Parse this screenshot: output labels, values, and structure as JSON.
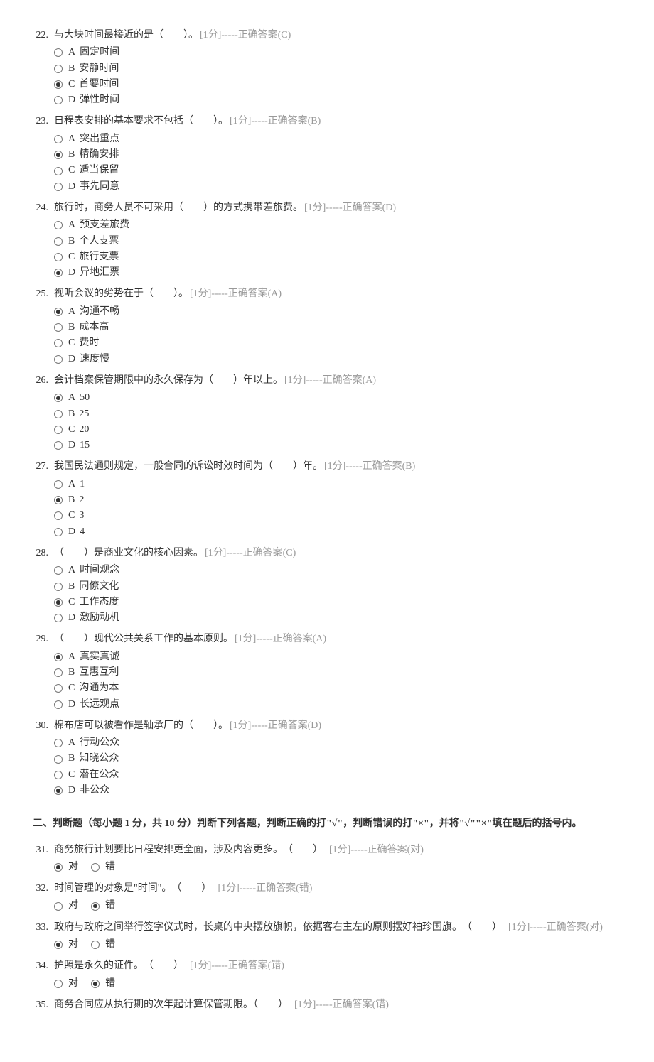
{
  "mc": [
    {
      "num": 22,
      "stem": "与大块时间最接近的是（　　）。",
      "score": "[1分]",
      "ans": "-----正确答案(C)",
      "opts": [
        {
          "l": "A",
          "t": "固定时间"
        },
        {
          "l": "B",
          "t": "安静时间"
        },
        {
          "l": "C",
          "t": "首要时间"
        },
        {
          "l": "D",
          "t": "弹性时间"
        }
      ],
      "sel": "C"
    },
    {
      "num": 23,
      "stem": "日程表安排的基本要求不包括（　　）。",
      "score": "[1分]",
      "ans": "-----正确答案(B)",
      "opts": [
        {
          "l": "A",
          "t": "突出重点"
        },
        {
          "l": "B",
          "t": "精确安排"
        },
        {
          "l": "C",
          "t": "适当保留"
        },
        {
          "l": "D",
          "t": "事先同意"
        }
      ],
      "sel": "B"
    },
    {
      "num": 24,
      "stem": "旅行时，商务人员不可采用（　　）的方式携带差旅费。",
      "score": "[1分]",
      "ans": "-----正确答案(D)",
      "opts": [
        {
          "l": "A",
          "t": "预支差旅费"
        },
        {
          "l": "B",
          "t": "个人支票"
        },
        {
          "l": "C",
          "t": "旅行支票"
        },
        {
          "l": "D",
          "t": "异地汇票"
        }
      ],
      "sel": "D"
    },
    {
      "num": 25,
      "stem": "视听会议的劣势在于（　　）。",
      "score": "[1分]",
      "ans": "-----正确答案(A)",
      "opts": [
        {
          "l": "A",
          "t": "沟通不畅"
        },
        {
          "l": "B",
          "t": "成本高"
        },
        {
          "l": "C",
          "t": "费时"
        },
        {
          "l": "D",
          "t": "速度慢"
        }
      ],
      "sel": "A"
    },
    {
      "num": 26,
      "stem": "会计档案保管期限中的永久保存为（　　）年以上。",
      "score": "[1分]",
      "ans": "-----正确答案(A)",
      "opts": [
        {
          "l": "A",
          "t": "50"
        },
        {
          "l": "B",
          "t": "25"
        },
        {
          "l": "C",
          "t": "20"
        },
        {
          "l": "D",
          "t": "15"
        }
      ],
      "sel": "A"
    },
    {
      "num": 27,
      "stem": "我国民法通则规定，一般合同的诉讼时效时间为（　　）年。",
      "score": "[1分]",
      "ans": "-----正确答案(B)",
      "opts": [
        {
          "l": "A",
          "t": "1"
        },
        {
          "l": "B",
          "t": "2"
        },
        {
          "l": "C",
          "t": "3"
        },
        {
          "l": "D",
          "t": "4"
        }
      ],
      "sel": "B"
    },
    {
      "num": 28,
      "stem": "（　　）是商业文化的核心因素。",
      "score": "[1分]",
      "ans": "-----正确答案(C)",
      "opts": [
        {
          "l": "A",
          "t": "时间观念"
        },
        {
          "l": "B",
          "t": "同僚文化"
        },
        {
          "l": "C",
          "t": "工作态度"
        },
        {
          "l": "D",
          "t": "激励动机"
        }
      ],
      "sel": "C"
    },
    {
      "num": 29,
      "stem": "（　　）现代公共关系工作的基本原则。",
      "score": "[1分]",
      "ans": "-----正确答案(A)",
      "opts": [
        {
          "l": "A",
          "t": "真实真诚"
        },
        {
          "l": "B",
          "t": "互惠互利"
        },
        {
          "l": "C",
          "t": "沟通为本"
        },
        {
          "l": "D",
          "t": "长远观点"
        }
      ],
      "sel": "A"
    },
    {
      "num": 30,
      "stem": "棉布店可以被看作是轴承厂的（　　）。",
      "score": "[1分]",
      "ans": "-----正确答案(D)",
      "opts": [
        {
          "l": "A",
          "t": "行动公众"
        },
        {
          "l": "B",
          "t": "知晓公众"
        },
        {
          "l": "C",
          "t": "潜在公众"
        },
        {
          "l": "D",
          "t": "非公众"
        }
      ],
      "sel": "D"
    }
  ],
  "section2_title": "二、判断题（每小题 1 分，共 10 分）判断下列各题，判断正确的打\"√\"，判断错误的打\"×\"，并将\"√\"\"×\"填在题后的括号内。",
  "tf_labels": {
    "t": "对",
    "f": "错"
  },
  "tf": [
    {
      "num": 31,
      "stem": "商务旅行计划要比日程安排更全面，涉及内容更多。　（　　）",
      "score": "[1分]",
      "ans": "-----正确答案(对)",
      "sel": "t"
    },
    {
      "num": 32,
      "stem": "时间管理的对象是\"时间\"。　（　　）",
      "score": "[1分]",
      "ans": "-----正确答案(错)",
      "sel": "f"
    },
    {
      "num": 33,
      "stem": "政府与政府之间举行签字仪式时，长桌的中央摆放旗帜，依据客右主左的原则摆好袖珍国旗。　（　　）",
      "score": "[1分]",
      "ans": "-----正确答案(对)",
      "sel": "t"
    },
    {
      "num": 34,
      "stem": "护照是永久的证件。　（　　）",
      "score": "[1分]",
      "ans": "-----正确答案(错)",
      "sel": "f"
    },
    {
      "num": 35,
      "stem": "商务合同应从执行期的次年起计算保管期限。（　　）",
      "score": "[1分]",
      "ans": "-----正确答案(错)",
      "sel": null
    }
  ]
}
